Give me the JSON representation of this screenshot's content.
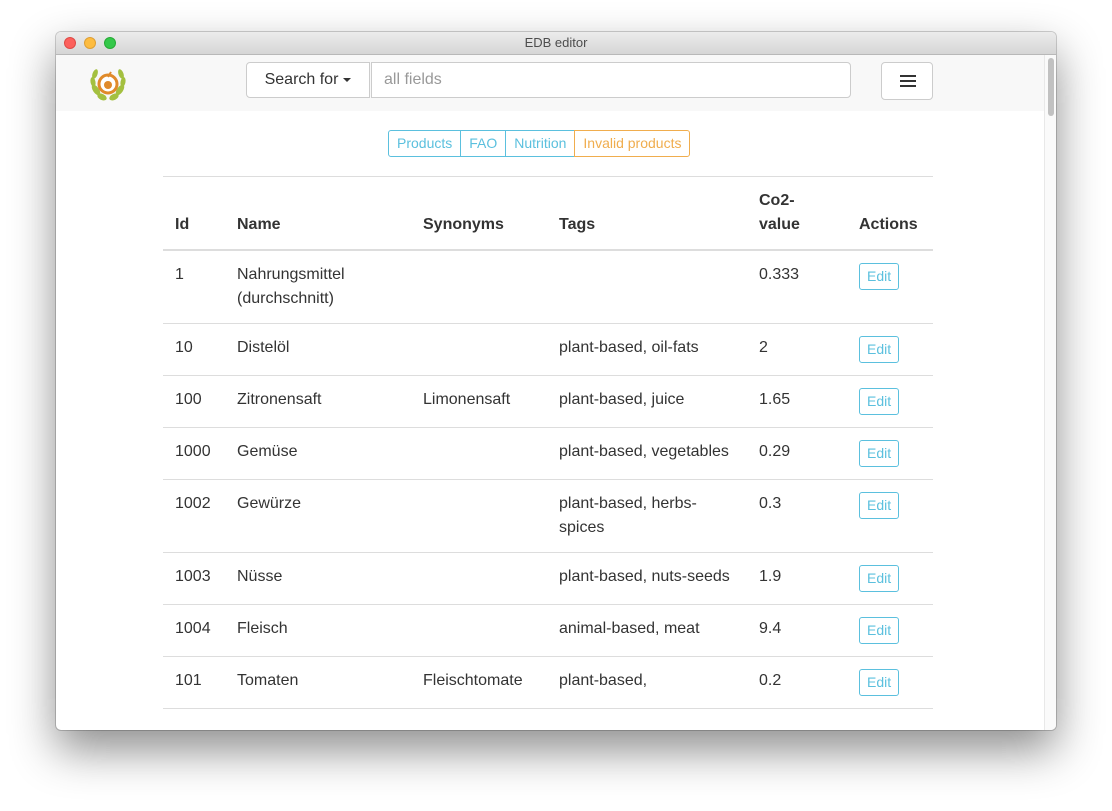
{
  "window": {
    "title": "EDB editor"
  },
  "navbar": {
    "search_dropdown_label": "Search for",
    "search_placeholder": "all fields"
  },
  "tabs": [
    {
      "label": "Products"
    },
    {
      "label": "FAO"
    },
    {
      "label": "Nutrition"
    },
    {
      "label": "Invalid products"
    }
  ],
  "table": {
    "headers": {
      "id": "Id",
      "name": "Name",
      "synonyms": "Synonyms",
      "tags": "Tags",
      "co2": "Co2-value",
      "actions": "Actions"
    },
    "rows": [
      {
        "id": "1",
        "name": "Nahrungsmittel (durchschnitt)",
        "synonyms": "",
        "tags": "",
        "co2": "0.333",
        "action": "Edit"
      },
      {
        "id": "10",
        "name": "Distelöl",
        "synonyms": "",
        "tags": "plant-based, oil-fats",
        "co2": "2",
        "action": "Edit"
      },
      {
        "id": "100",
        "name": "Zitronensaft",
        "synonyms": "Limonensaft",
        "tags": "plant-based, juice",
        "co2": "1.65",
        "action": "Edit"
      },
      {
        "id": "1000",
        "name": "Gemüse",
        "synonyms": "",
        "tags": "plant-based, vegetables",
        "co2": "0.29",
        "action": "Edit"
      },
      {
        "id": "1002",
        "name": "Gewürze",
        "synonyms": "",
        "tags": "plant-based, herbs-spices",
        "co2": "0.3",
        "action": "Edit"
      },
      {
        "id": "1003",
        "name": "Nüsse",
        "synonyms": "",
        "tags": "plant-based, nuts-seeds",
        "co2": "1.9",
        "action": "Edit"
      },
      {
        "id": "1004",
        "name": "Fleisch",
        "synonyms": "",
        "tags": "animal-based, meat",
        "co2": "9.4",
        "action": "Edit"
      },
      {
        "id": "101",
        "name": "Tomaten",
        "synonyms": "Fleischtomate",
        "tags": "plant-based,",
        "co2": "0.2",
        "action": "Edit"
      }
    ]
  },
  "colors": {
    "info": "#5bc0de",
    "warning": "#f0ad4e",
    "navbar_bg": "#f8f8f8"
  },
  "icons": {
    "logo": "leaf-wreath-logo",
    "menu": "hamburger-menu-icon"
  }
}
